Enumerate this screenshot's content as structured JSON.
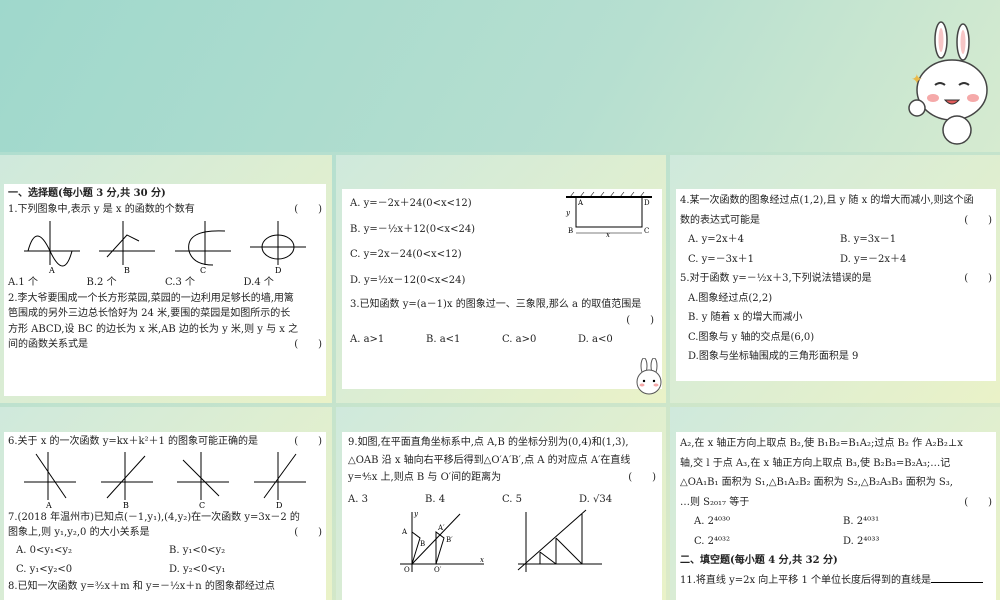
{
  "panel1": {
    "section": "一、选择题(每小题 3 分,共 30 分)",
    "q1": "1.下列图象中,表示 y 是 x 的函数的个数有",
    "bracket": "(　　)",
    "fig_labels": [
      "A",
      "B",
      "C",
      "D"
    ],
    "q1_options": [
      "A.1 个",
      "B.2 个",
      "C.3 个",
      "D.4 个"
    ],
    "q2_lines": [
      "2.李大爷要围成一个长方形菜园,菜园的一边利用足够长的墙,用篱",
      "笆围成的另外三边总长恰好为 24 米,要围的菜园是如图所示的长",
      "方形 ABCD,设 BC 的边长为 x 米,AB 边的长为 y 米,则 y 与 x 之",
      "间的函数关系式是"
    ]
  },
  "panel2": {
    "q2_options": [
      "A. y=－2x＋24(0<x<12)",
      "B. y=－½x＋12(0<x<24)",
      "C. y=2x－24(0<x<12)",
      "D. y=½x－12(0<x<24)"
    ],
    "fig_letters": {
      "A": "A",
      "D": "D",
      "B": "B",
      "C": "C",
      "x": "x",
      "y": "y"
    },
    "q3": "3.已知函数 y=(a－1)x 的图象过一、三象限,那么 a 的取值范围是",
    "bracket": "(　　)",
    "q3_options": [
      "A. a>1",
      "B. a<1",
      "C. a>0",
      "D. a<0"
    ]
  },
  "panel3": {
    "q4_lines": [
      "4.某一次函数的图象经过点(1,2),且 y 随 x 的增大而减小,则这个函",
      "数的表达式可能是"
    ],
    "bracket": "(　　)",
    "q4_options": [
      "A. y=2x＋4",
      "B. y=3x－1",
      "C. y=－3x＋1",
      "D. y=－2x＋4"
    ],
    "q5": "5.对于函数 y=－½x＋3,下列说法错误的是",
    "q5_options": [
      "A.图象经过点(2,2)",
      "B. y 随着 x 的增大而减小",
      "C.图象与 y 轴的交点是(6,0)",
      "D.图象与坐标轴围成的三角形面积是 9"
    ]
  },
  "panel4": {
    "q6": "6.关于 x 的一次函数 y=kx＋k²＋1 的图象可能正确的是",
    "bracket": "(　　)",
    "fig_labels": [
      "A",
      "B",
      "C",
      "D"
    ],
    "q7_lines": [
      "7.(2018 年温州市)已知点(－1,y₁),(4,y₂)在一次函数 y=3x－2 的",
      "图象上,则 y₁,y₂,0 的大小关系是"
    ],
    "q7_options": [
      "A. 0<y₁<y₂",
      "B. y₁<0<y₂",
      "C. y₁<y₂<0",
      "D. y₂<0<y₁"
    ],
    "q8": "8.已知一次函数 y=³⁄₂x＋m 和 y=－½x＋n 的图象都经过点"
  },
  "panel5": {
    "q9_lines": [
      "9.如图,在平面直角坐标系中,点 A,B 的坐标分别为(0,4)和(1,3),",
      "△OAB 沿 x 轴向右平移后得到△O′A′B′,点 A 的对应点 A′在直线",
      "y=⅘x 上,则点 B 与 O′间的距离为"
    ],
    "bracket": "(　　)",
    "q9_options": [
      "A. 3",
      "B. 4",
      "C. 5",
      "D. √34"
    ],
    "fig_letters": {
      "y": "y",
      "x": "x",
      "A": "A",
      "B": "B",
      "O": "O",
      "A2": "A′",
      "B2": "B′",
      "O2": "O′"
    }
  },
  "panel6": {
    "q10_lines": [
      "A₂,在 x 轴正方向上取点 B₂,使 B₁B₂=B₁A₂;过点 B₂ 作 A₂B₂⊥x",
      "轴,交 l 于点 A₃,在 x 轴正方向上取点 B₃,使 B₂B₃=B₂A₃;…记",
      "△OA₁B₁ 面积为 S₁,△B₁A₂B₂ 面积为 S₂,△B₂A₃B₃ 面积为 S₃,",
      "…则 S₂₀₁₇ 等于"
    ],
    "bracket": "(　　)",
    "q10_options": [
      "A. 2⁴⁰³⁰",
      "B. 2⁴⁰³¹",
      "C. 2⁴⁰³²",
      "D. 2⁴⁰³³"
    ],
    "section": "二、填空题(每小题 4 分,共 32 分)",
    "q11": "11.将直线 y=2x 向上平移 1 个单位长度后得到的直线是"
  }
}
